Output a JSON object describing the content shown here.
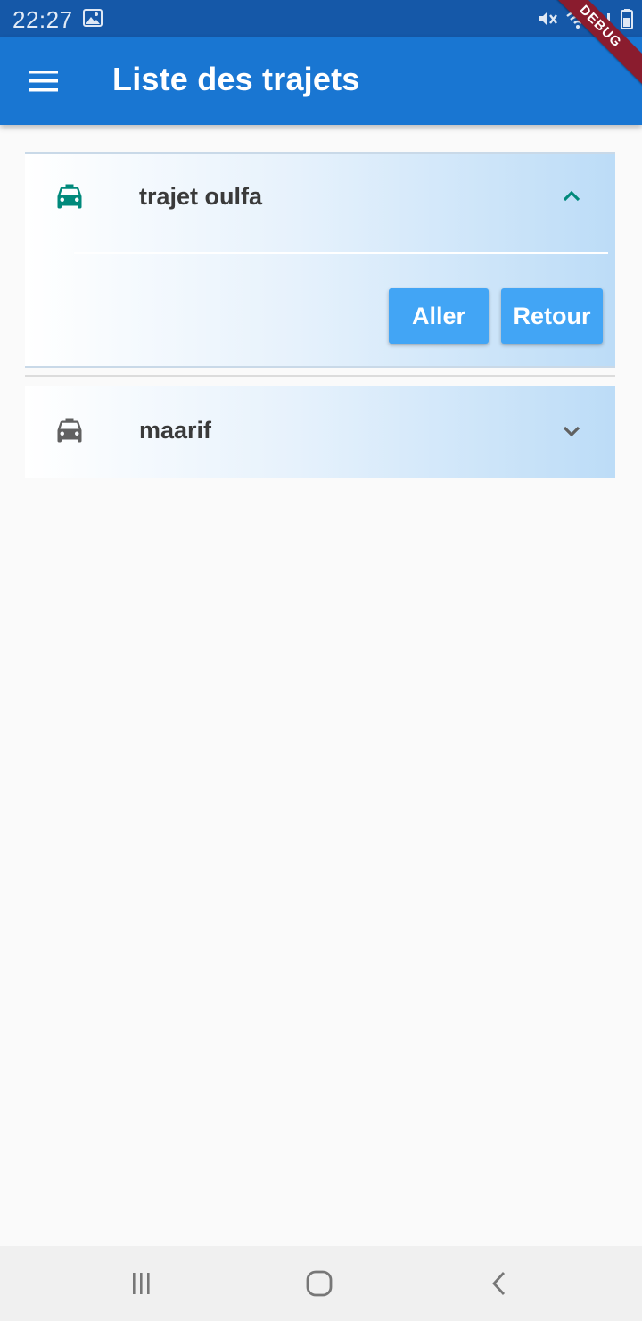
{
  "status_bar": {
    "time": "22:27",
    "icons": [
      "image-icon",
      "mute-icon",
      "wifi-icon",
      "signal-icon",
      "battery-icon"
    ],
    "debug_label": "DEBUG"
  },
  "app_bar": {
    "title": "Liste des trajets",
    "menu_icon": "menu-icon",
    "background": "#1976d2"
  },
  "trajets": [
    {
      "name": "trajet oulfa",
      "expanded": true,
      "icon": "taxi-icon",
      "icon_color": "#00897b",
      "chevron": "chevron-up-icon",
      "actions": [
        "Aller",
        "Retour"
      ]
    },
    {
      "name": "maarif",
      "expanded": false,
      "icon": "taxi-icon",
      "icon_color": "#616161",
      "chevron": "chevron-down-icon"
    }
  ],
  "accent_colors": {
    "button": "#42a5f5",
    "status_bar": "#1558a8",
    "debug_banner": "#8a1c2e"
  },
  "nav_bar": {
    "buttons": [
      "recents-icon",
      "home-icon",
      "back-icon"
    ]
  }
}
